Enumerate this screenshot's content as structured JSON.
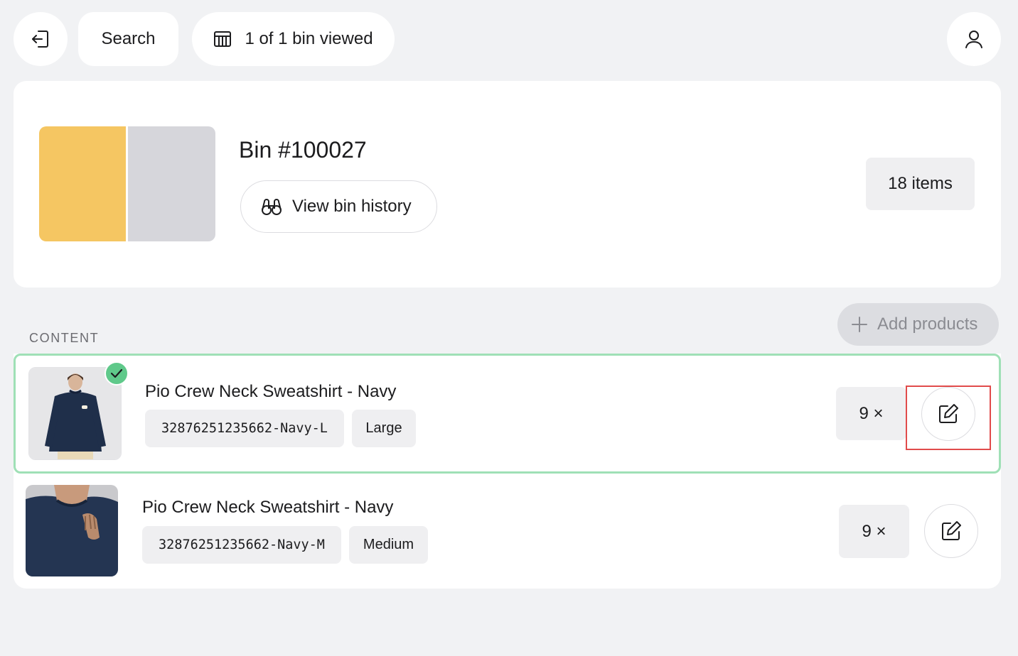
{
  "topbar": {
    "search_label": "Search",
    "bins_label": "1 of 1 bin viewed",
    "icons": {
      "exit": "exit-icon",
      "bins": "table-icon",
      "user": "user-icon"
    }
  },
  "bin": {
    "title": "Bin #100027",
    "history_label": "View bin history",
    "count_label": "18 items",
    "colors": {
      "left": "#f5c662",
      "right": "#d6d6db"
    }
  },
  "content": {
    "section_label": "CONTENT",
    "add_label": "Add products",
    "items": [
      {
        "name": "Pio Crew Neck Sweatshirt - Navy",
        "sku": "32876251235662-Navy-L",
        "size": "Large",
        "qty": "9 ×",
        "checked": true
      },
      {
        "name": "Pio Crew Neck Sweatshirt - Navy",
        "sku": "32876251235662-Navy-M",
        "size": "Medium",
        "qty": "9 ×",
        "checked": false
      }
    ]
  },
  "colors": {
    "accent_check": "#5fc98a",
    "selected_border": "#9fe0b6",
    "highlight_box": "#e14b4b",
    "navy": "#1f2f4a"
  }
}
